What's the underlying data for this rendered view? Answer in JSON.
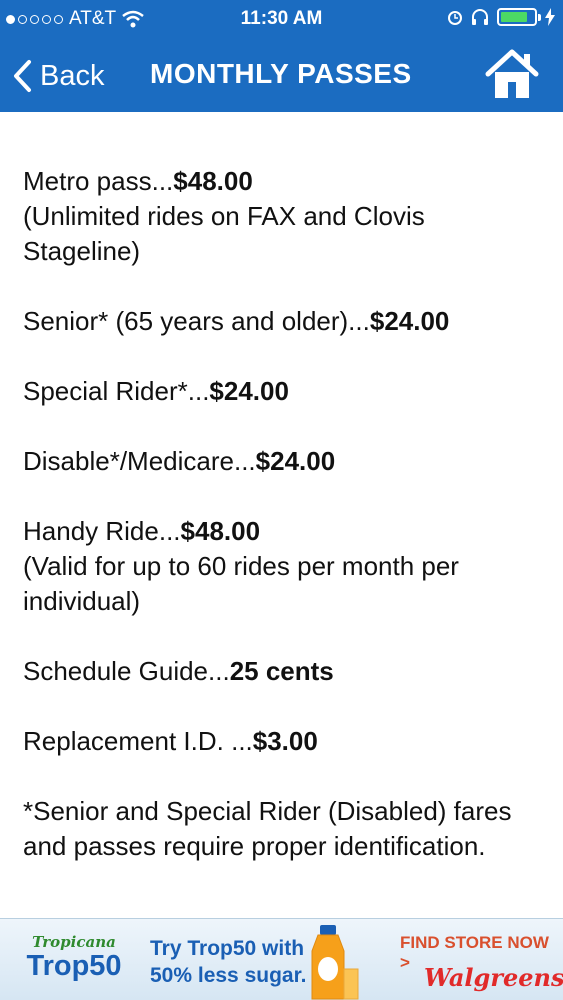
{
  "status_bar": {
    "carrier": "AT&T",
    "time": "11:30 AM",
    "signal_bars": 1,
    "battery_level": 0.8,
    "battery_color": "#4cd964"
  },
  "nav": {
    "back_label": "Back",
    "title": "MONTHLY PASSES",
    "home_icon": "home-icon",
    "bar_color": "#1b6cc1"
  },
  "fares": [
    {
      "label": "Metro pass...",
      "price": "$48.00",
      "note": "(Unlimited rides on FAX and Clovis Stageline)"
    },
    {
      "label": "Senior* (65 years and older)...",
      "price": "$24.00",
      "note": ""
    },
    {
      "label": "Special Rider*...",
      "price": "$24.00",
      "note": ""
    },
    {
      "label": "Disable*/Medicare...",
      "price": "$24.00",
      "note": ""
    },
    {
      "label": "Handy Ride...",
      "price": "$48.00",
      "note": "(Valid for up to 60 rides per month per individual)"
    },
    {
      "label": "Schedule Guide...",
      "price": "25 cents",
      "note": ""
    },
    {
      "label": "Replacement I.D. ...",
      "price": "$3.00",
      "note": ""
    }
  ],
  "footnote": "*Senior and Special Rider (Disabled) fares and passes require proper identification.",
  "ad": {
    "brand_small": "Tropicana",
    "brand_big": "Trop50",
    "line1": "Try Trop50 with",
    "line2": "50% less sugar.",
    "cta": "FIND STORE NOW >",
    "store": "Walgreens"
  }
}
